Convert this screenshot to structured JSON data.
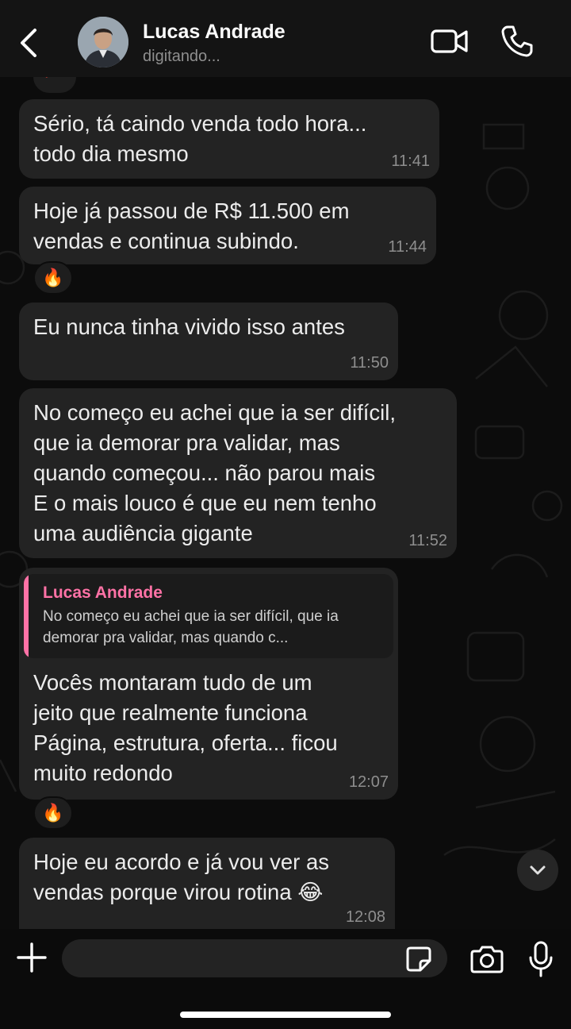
{
  "header": {
    "contact_name": "Lucas Andrade",
    "status": "digitando..."
  },
  "messages": [
    {
      "text": "Sério, tá caindo venda todo hora...\ntodo dia mesmo",
      "time": "11:41"
    },
    {
      "text": "Hoje já passou de R$ 11.500 em\nvendas e continua subindo.",
      "time": "11:44",
      "reaction": "🔥"
    },
    {
      "text": "Eu nunca tinha vivido isso antes",
      "time": "11:50"
    },
    {
      "text": "No começo eu achei que ia ser difícil,\nque ia demorar pra validar, mas\nquando começou... não parou mais\nE o mais louco é que eu nem tenho\numa audiência gigante",
      "time": "11:52"
    },
    {
      "quote": {
        "author": "Lucas Andrade",
        "text": "No começo eu achei que ia ser difícil, que ia\ndemorar pra validar, mas quando c..."
      },
      "text": "Vocês montaram tudo de um\njeito que realmente funciona\nPágina, estrutura, oferta... ficou\nmuito redondo",
      "time": "12:07",
      "reaction": "🔥"
    },
    {
      "text": "Hoje eu acordo e já vou ver as\nvendas porque virou rotina 😂",
      "time": "12:08"
    }
  ],
  "top_reaction": "💯",
  "input": {
    "placeholder": ""
  },
  "colors": {
    "bubble": "#232323",
    "quote_accent": "#ff72a6",
    "background": "#0c0c0c"
  },
  "icons": [
    "back-arrow-icon",
    "video-call-icon",
    "phone-icon",
    "plus-icon",
    "sticker-icon",
    "camera-icon",
    "microphone-icon",
    "chevron-down-icon"
  ]
}
